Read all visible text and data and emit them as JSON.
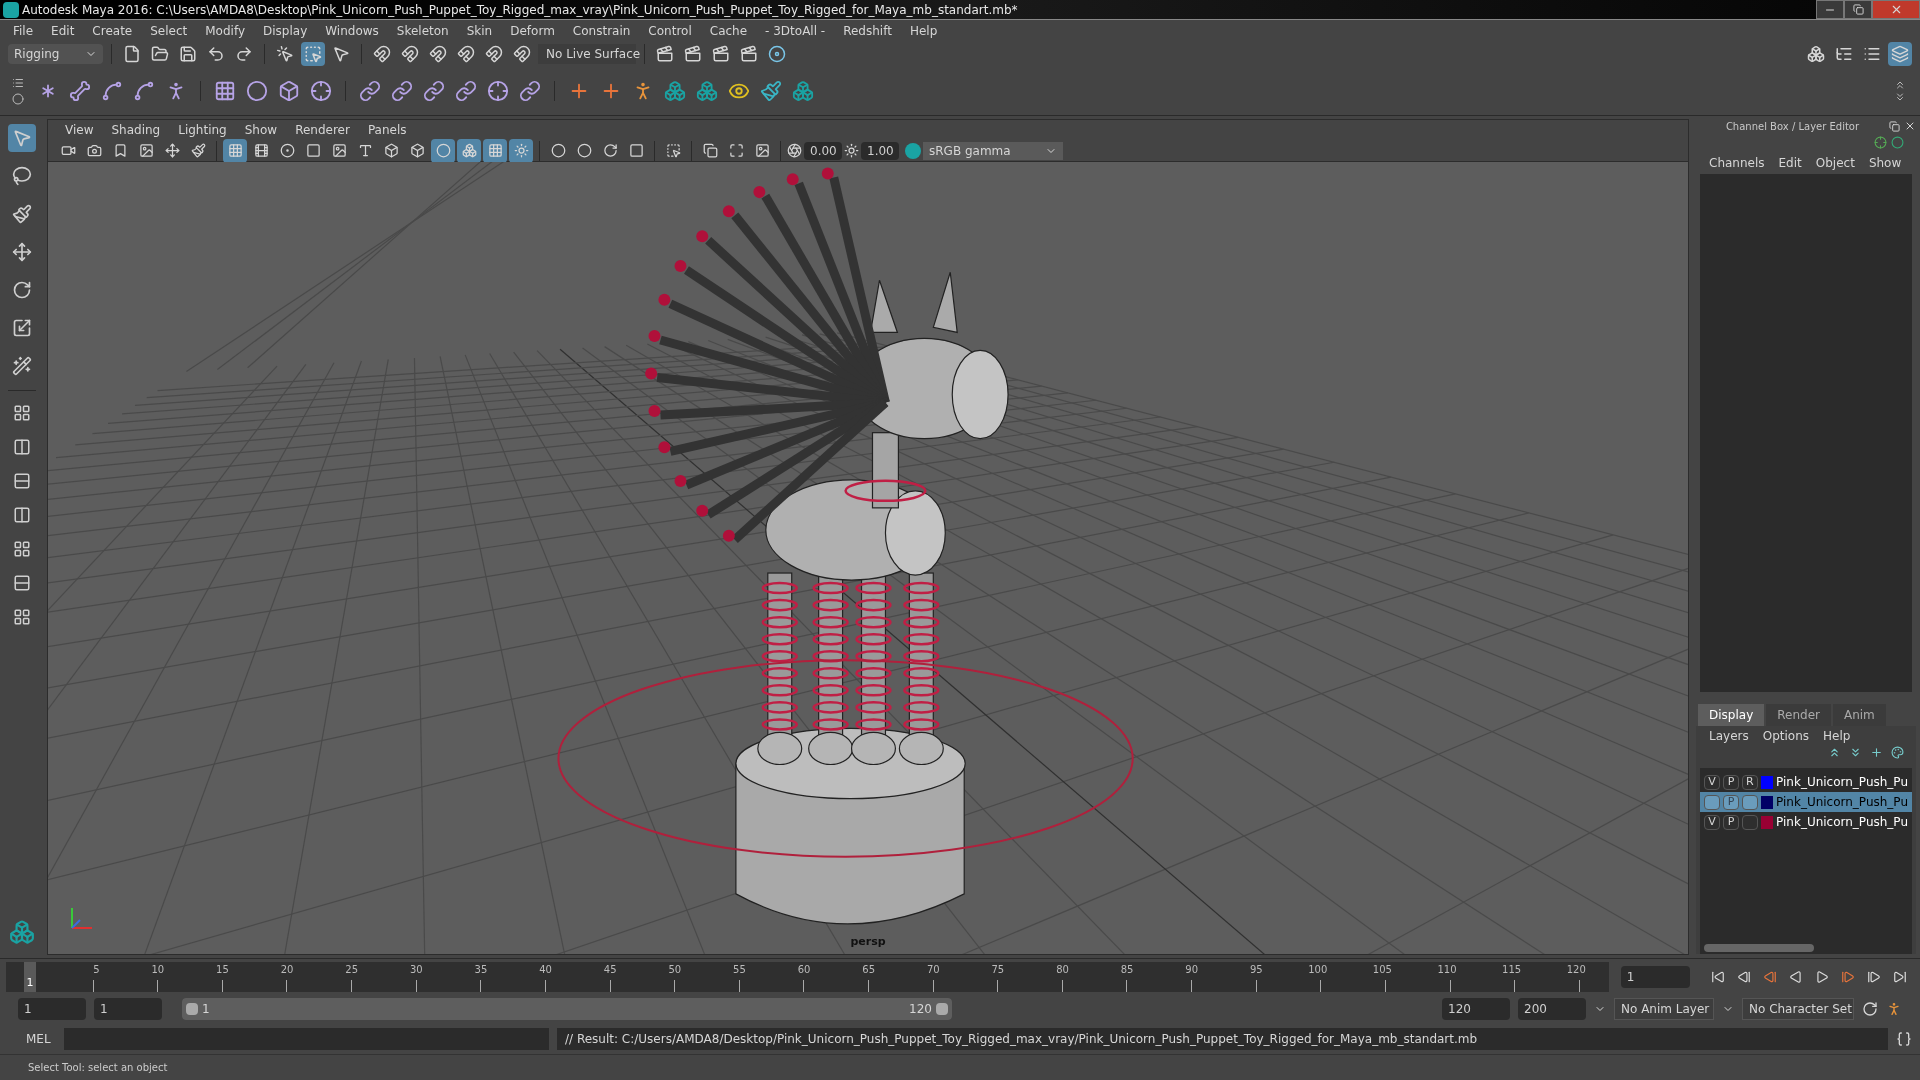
{
  "window": {
    "title": "Autodesk Maya 2016: C:\\Users\\AMDA8\\Desktop\\Pink_Unicorn_Push_Puppet_Toy_Rigged_max_vray\\Pink_Unicorn_Push_Puppet_Toy_Rigged_for_Maya_mb_standart.mb*"
  },
  "menu_bar": [
    "File",
    "Edit",
    "Create",
    "Select",
    "Modify",
    "Display",
    "Windows",
    "Skeleton",
    "Skin",
    "Deform",
    "Constrain",
    "Control",
    "Cache",
    "- 3DtoAll -",
    "Redshift",
    "Help"
  ],
  "status_line": {
    "mode": "Rigging",
    "live_surface": "No Live Surface",
    "select_modes": [
      {
        "selected": false
      },
      {
        "selected": true
      },
      {
        "selected": false
      }
    ]
  },
  "toolbox": {
    "tools": [
      {
        "selected": true
      },
      {
        "selected": false
      },
      {
        "selected": false
      },
      {
        "selected": false
      },
      {
        "selected": false
      },
      {
        "selected": false
      },
      {
        "selected": false
      }
    ]
  },
  "viewport": {
    "menu": [
      "View",
      "Shading",
      "Lighting",
      "Show",
      "Renderer",
      "Panels"
    ],
    "toggles": [
      {
        "on": true
      },
      {
        "on": false
      },
      {
        "on": false
      },
      {
        "on": false
      },
      {
        "on": false
      },
      {
        "on": false
      },
      {
        "on": false
      },
      {
        "on": false
      },
      {
        "on": true
      },
      {
        "on": true
      },
      {
        "on": true
      },
      {
        "on": true
      }
    ],
    "exposure": "0.00",
    "gamma": "1.00",
    "color_space": "sRGB gamma",
    "camera": "persp"
  },
  "channel_box": {
    "title": "Channel Box / Layer Editor",
    "menu": [
      "Channels",
      "Edit",
      "Object",
      "Show"
    ]
  },
  "layer_editor": {
    "tabs": [
      {
        "label": "Display",
        "selected": true
      },
      {
        "label": "Render",
        "selected": false
      },
      {
        "label": "Anim",
        "selected": false
      }
    ],
    "menu": [
      "Layers",
      "Options",
      "Help"
    ],
    "layers": [
      {
        "v": "V",
        "p": "P",
        "r": "R",
        "name": "Pink_Unicorn_Push_Pu",
        "color": "#0000ff",
        "selected": false
      },
      {
        "p": "P",
        "name": "Pink_Unicorn_Push_Pu",
        "color": "#000066",
        "selected": true
      },
      {
        "v": "V",
        "p": "P",
        "name": "Pink_Unicorn_Push_Pu",
        "color": "#990033",
        "selected": false
      }
    ]
  },
  "timeline": {
    "ticks": [
      "5",
      "10",
      "15",
      "20",
      "25",
      "30",
      "35",
      "40",
      "45",
      "50",
      "55",
      "60",
      "65",
      "70",
      "75",
      "80",
      "85",
      "90",
      "95",
      "100",
      "105",
      "110",
      "115",
      "120"
    ],
    "current_frame": "1",
    "frame_field": "1",
    "level": 0
  },
  "range": {
    "level": 1,
    "start": "1",
    "playback_start": "1",
    "slider_start": "1",
    "slider_end": "120",
    "playback_end": "120",
    "end": "200",
    "anim_layer": "No Anim Layer",
    "character_set": "No Character Set"
  },
  "command_line": {
    "language": "MEL",
    "result": "// Result: C:/Users/AMDA8/Desktop/Pink_Unicorn_Push_Puppet_Toy_Rigged_max_vray/Pink_Unicorn_Push_Puppet_Toy_Rigged_for_Maya_mb_standart.mb"
  },
  "help_line": "Select Tool: select an object"
}
